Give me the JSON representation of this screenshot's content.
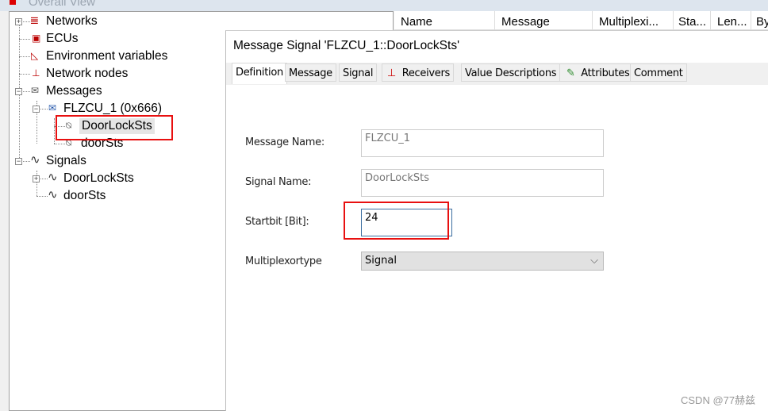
{
  "window": {
    "title": "Overall View"
  },
  "tree": {
    "items": [
      {
        "label": "Networks",
        "icon": "network-icon",
        "expander": "+"
      },
      {
        "label": "ECUs",
        "icon": "ecu-icon"
      },
      {
        "label": "Environment variables",
        "icon": "gauge-icon"
      },
      {
        "label": "Network nodes",
        "icon": "node-icon"
      },
      {
        "label": "Messages",
        "icon": "envelope-icon",
        "expander": "-"
      },
      {
        "label": "FLZCU_1 (0x666)",
        "icon": "fd-message-icon",
        "expander": "-"
      },
      {
        "label": "DoorLockSts",
        "icon": "message-signal-icon",
        "selected": true
      },
      {
        "label": "doorSts",
        "icon": "message-signal-icon"
      },
      {
        "label": "Signals",
        "icon": "signal-wave-icon",
        "expander": "-"
      },
      {
        "label": "DoorLockSts",
        "icon": "signal-wave-icon",
        "expander": "+"
      },
      {
        "label": "doorSts",
        "icon": "signal-wave-icon"
      }
    ]
  },
  "list": {
    "columns": [
      "Name",
      "Message",
      "Multiplexi...",
      "Sta...",
      "Len...",
      "By"
    ]
  },
  "dialog": {
    "title": "Message Signal 'FLZCU_1::DoorLockSts'",
    "tabs": [
      {
        "label": "Definition",
        "active": true
      },
      {
        "label": "Message"
      },
      {
        "label": "Signal"
      },
      {
        "label": "Receivers",
        "icon": "receivers-icon"
      },
      {
        "label": "Value Descriptions"
      },
      {
        "label": "Attributes",
        "icon": "attributes-icon"
      },
      {
        "label": "Comment"
      }
    ],
    "fields": {
      "message_name": {
        "label": "Message Name:",
        "value": "FLZCU_1"
      },
      "signal_name": {
        "label": "Signal Name:",
        "value": "DoorLockSts"
      },
      "startbit": {
        "label": "Startbit [Bit]:",
        "value": "24"
      },
      "multiplexortype": {
        "label": "Multiplexortype",
        "value": "Signal"
      }
    }
  },
  "annotations": {
    "highlight_color": "#e81010"
  },
  "watermark": "CSDN @77赫兹"
}
